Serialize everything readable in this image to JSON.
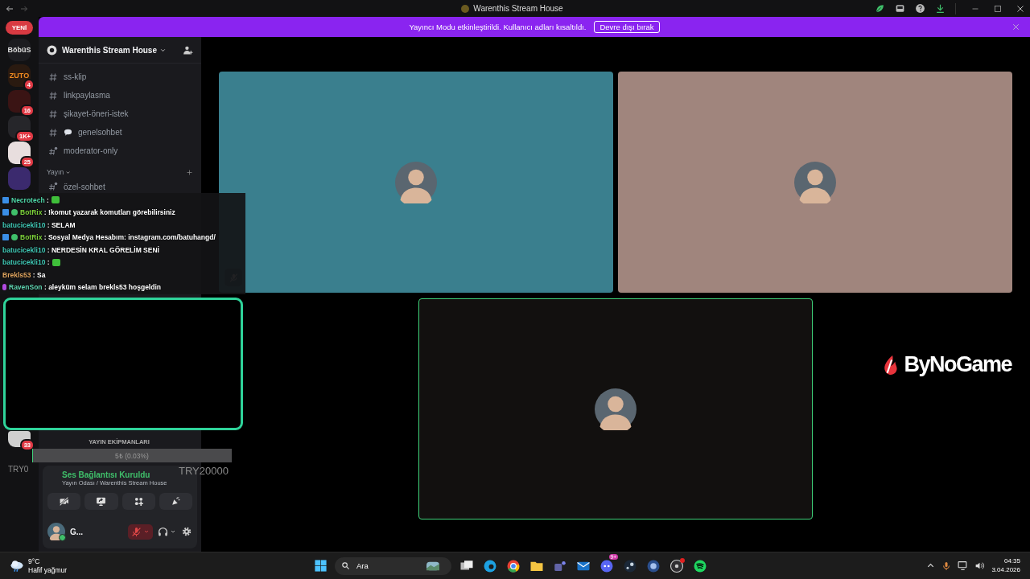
{
  "titlebar": {
    "title": "Warenthis Stream House"
  },
  "notice": {
    "new_badge": "YENİ",
    "message": "Yayıncı Modu etkinleştirildi. Kullanıcı adları kısaltıldı.",
    "button": "Devre dışı bırak"
  },
  "servers": [
    {
      "label": "BöbüS",
      "color": "#1c1c20"
    },
    {
      "label": "ZUTO",
      "badge": "4",
      "color": "#2a1a10"
    },
    {
      "badge": "16",
      "color": "#3a1414"
    },
    {
      "badge": "1K+",
      "color": "#26262a"
    },
    {
      "badge": "25",
      "color": "#e8dede"
    },
    {
      "color": "#3b2a6e"
    },
    {
      "badge": "33",
      "color": "#cfcfcf"
    }
  ],
  "server": {
    "name": "Warenthis Stream House"
  },
  "channels": [
    {
      "name": "ss-klip",
      "kind": "text"
    },
    {
      "name": "linkpaylasma",
      "kind": "text"
    },
    {
      "name": "şikayet-öneri-istek",
      "kind": "text"
    },
    {
      "name": "genelsohbet",
      "kind": "chat"
    },
    {
      "name": "moderator-only",
      "kind": "locked"
    }
  ],
  "category": {
    "name": "Yayın",
    "channels": [
      {
        "name": "özel-sohbet",
        "kind": "locked"
      }
    ]
  },
  "voice": {
    "status": "Ses Bağlantısı Kuruldu",
    "location": "Yayın Odası / Warenthis Stream House"
  },
  "user": {
    "name": "G...",
    "muted": true
  },
  "tiles": [
    {
      "color": "#3a7f8e",
      "speaking": false,
      "muted": true
    },
    {
      "color": "#a0857d",
      "speaking": false,
      "muted": false
    },
    {
      "color": "#12100f",
      "speaking": true,
      "muted": false
    }
  ],
  "overlay": {
    "logo": "ByNoGame",
    "chat": [
      {
        "user": "Necrotech",
        "color": "#4fd7a8",
        "kind": "subscriber",
        "text": ":",
        "emote": true
      },
      {
        "user": "BotRix",
        "color": "#7cd13a",
        "kind": "bot",
        "text": ": !komut yazarak komutları görebilirsiniz"
      },
      {
        "user": "batucicekli10",
        "color": "#3fc7b4",
        "kind": "plain",
        "text": ": SELAM"
      },
      {
        "user": "BotRix",
        "color": "#7cd13a",
        "kind": "bot",
        "text": ": Sosyal Medya Hesabım: instagram.com/batuhangd/"
      },
      {
        "user": "batucicekli10",
        "color": "#3fc7b4",
        "kind": "plain",
        "text": ": NERDESİN KRAL GÖRELİM SENİ"
      },
      {
        "user": "batucicekli10",
        "color": "#3fc7b4",
        "kind": "plain",
        "text": ":",
        "emote": true
      },
      {
        "user": "Brekls53",
        "color": "#e0a560",
        "kind": "plain",
        "text": ": Sa"
      },
      {
        "user": "RavenSon",
        "color": "#5fd4b0",
        "kind": "vip",
        "text": ": aleyküm selam brekls53 hoşgeldin"
      }
    ],
    "goal": {
      "title": "YAYIN EKİPMANLARI",
      "amount": "5₺ (0.03%)",
      "level": 0.0003,
      "min": "TRY0",
      "max": "TRY20000"
    }
  },
  "taskbar": {
    "temperature": "9°C",
    "weather": "Hafif yağmur",
    "search": "Ara",
    "notification_badge": "9+",
    "time": "04:35",
    "date": "3.04.2026"
  }
}
